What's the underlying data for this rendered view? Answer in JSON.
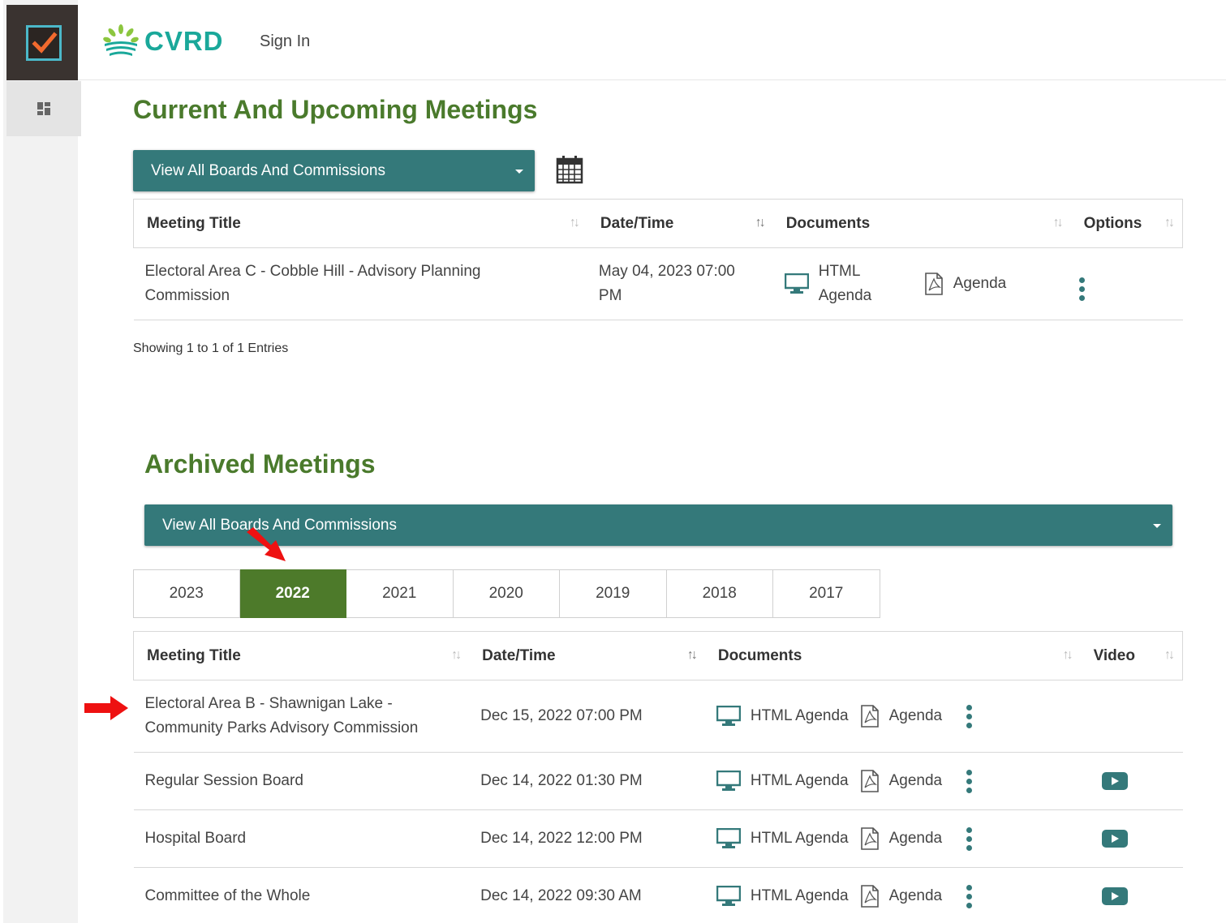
{
  "header": {
    "logo_text": "CVRD",
    "signin_label": "Sign In"
  },
  "colors": {
    "brand_teal": "#34797a",
    "title_green": "#4a7a2c",
    "active_year": "#4d7a2a",
    "logo_teal": "#1aa89a",
    "annotation_red": "#ee1111"
  },
  "current": {
    "title": "Current And Upcoming Meetings",
    "filter_label": "View All Boards And Commissions",
    "calendar_icon": "calendar-icon",
    "columns": [
      "Meeting Title",
      "Date/Time",
      "Documents",
      "Options"
    ],
    "rows": [
      {
        "title": "Electoral Area C - Cobble Hill - Advisory Planning Commission",
        "datetime": "May 04, 2023 07:00 PM",
        "html_agenda": "HTML Agenda",
        "agenda": "Agenda"
      }
    ],
    "entries_text": "Showing 1 to 1 of 1 Entries"
  },
  "archived": {
    "title": "Archived Meetings",
    "filter_label": "View All Boards And Commissions",
    "years": [
      "2023",
      "2022",
      "2021",
      "2020",
      "2019",
      "2018",
      "2017"
    ],
    "selected_year": "2022",
    "columns": [
      "Meeting Title",
      "Date/Time",
      "Documents",
      "Video"
    ],
    "rows": [
      {
        "title": "Electoral Area B - Shawnigan Lake - Community Parks Advisory Commission",
        "datetime": "Dec 15, 2022 07:00 PM",
        "html_agenda": "HTML Agenda",
        "agenda": "Agenda",
        "video": false
      },
      {
        "title": "Regular Session Board",
        "datetime": "Dec 14, 2022 01:30 PM",
        "html_agenda": "HTML Agenda",
        "agenda": "Agenda",
        "video": true
      },
      {
        "title": "Hospital Board",
        "datetime": "Dec 14, 2022 12:00 PM",
        "html_agenda": "HTML Agenda",
        "agenda": "Agenda",
        "video": true
      },
      {
        "title": "Committee of the Whole",
        "datetime": "Dec 14, 2022 09:30 AM",
        "html_agenda": "HTML Agenda",
        "agenda": "Agenda",
        "video": true
      }
    ]
  }
}
